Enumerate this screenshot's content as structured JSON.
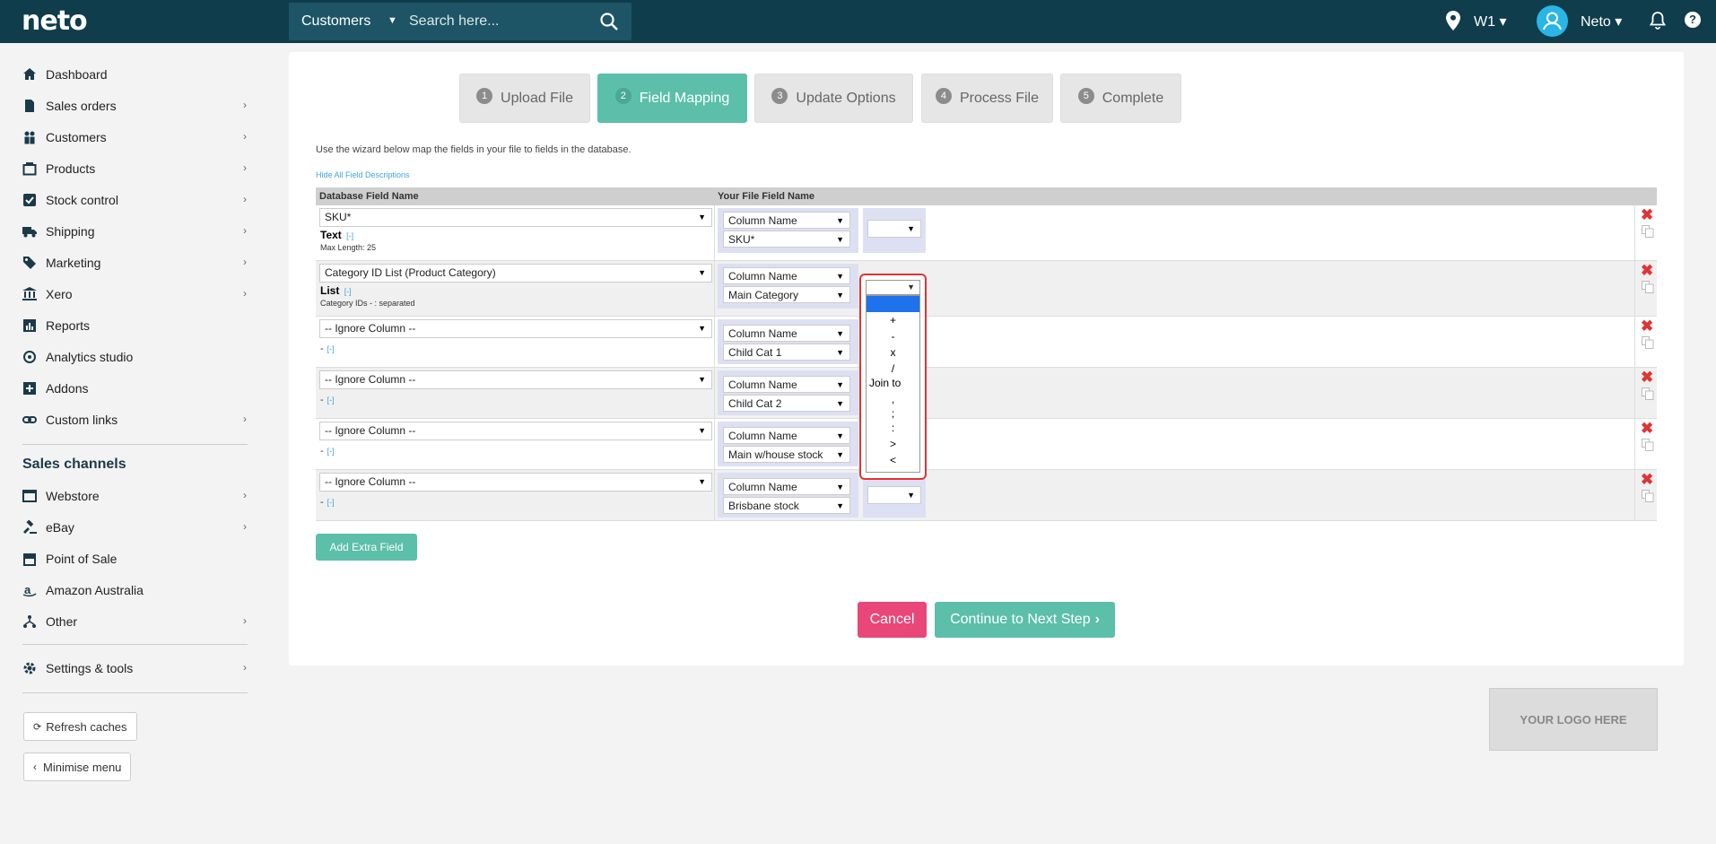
{
  "header": {
    "logo": "neto",
    "search_scope": "Customers",
    "search_placeholder": "Search here...",
    "location": "W1",
    "user": "Neto"
  },
  "sidebar": {
    "items": [
      {
        "label": "Dashboard",
        "icon": "home-icon",
        "chevron": false
      },
      {
        "label": "Sales orders",
        "icon": "document-icon",
        "chevron": true
      },
      {
        "label": "Customers",
        "icon": "users-icon",
        "chevron": true
      },
      {
        "label": "Products",
        "icon": "box-icon",
        "chevron": true
      },
      {
        "label": "Stock control",
        "icon": "checkbox-icon",
        "chevron": true
      },
      {
        "label": "Shipping",
        "icon": "truck-icon",
        "chevron": true
      },
      {
        "label": "Marketing",
        "icon": "tag-icon",
        "chevron": true
      },
      {
        "label": "Xero",
        "icon": "bank-icon",
        "chevron": true
      },
      {
        "label": "Reports",
        "icon": "chart-icon",
        "chevron": false
      },
      {
        "label": "Analytics studio",
        "icon": "analytics-icon",
        "chevron": false
      },
      {
        "label": "Addons",
        "icon": "plus-square-icon",
        "chevron": false
      },
      {
        "label": "Custom links",
        "icon": "link-icon",
        "chevron": true
      }
    ],
    "channels_title": "Sales channels",
    "channels": [
      {
        "label": "Webstore",
        "icon": "webstore-icon",
        "chevron": true
      },
      {
        "label": "eBay",
        "icon": "gavel-icon",
        "chevron": true
      },
      {
        "label": "Point of Sale",
        "icon": "store-icon",
        "chevron": false
      },
      {
        "label": "Amazon Australia",
        "icon": "amazon-icon",
        "chevron": false
      },
      {
        "label": "Other",
        "icon": "sitemap-icon",
        "chevron": true
      }
    ],
    "settings": "Settings & tools",
    "refresh": "Refresh caches",
    "minimise": "Minimise menu"
  },
  "wizard": {
    "steps": [
      {
        "num": "1",
        "label": "Upload File"
      },
      {
        "num": "2",
        "label": "Field Mapping"
      },
      {
        "num": "3",
        "label": "Update Options"
      },
      {
        "num": "4",
        "label": "Process File"
      },
      {
        "num": "5",
        "label": "Complete"
      }
    ],
    "intro": "Use the wizard below map the fields in your file to fields in the database.",
    "hide_link": "Hide All Field Descriptions",
    "col_db": "Database Field Name",
    "col_file": "Your File Field Name",
    "rows": [
      {
        "db": "SKU*",
        "type": "Text",
        "toggle": "[-]",
        "desc": "Max Length: 25",
        "map1": "Column Name",
        "map2": "SKU*"
      },
      {
        "db": "Category ID List (Product Category)",
        "type": "List",
        "toggle": "[-]",
        "desc": "Category IDs - : separated",
        "map1": "Column Name",
        "map2": "Main Category"
      },
      {
        "db": "-- Ignore Column --",
        "type": "-",
        "toggle": "[-]",
        "desc": "",
        "map1": "Column Name",
        "map2": "Child Cat 1"
      },
      {
        "db": "-- Ignore Column --",
        "type": "-",
        "toggle": "[-]",
        "desc": "",
        "map1": "Column Name",
        "map2": "Child Cat 2"
      },
      {
        "db": "-- Ignore Column --",
        "type": "-",
        "toggle": "[-]",
        "desc": "",
        "map1": "Column Name",
        "map2": "Main w/house stock"
      },
      {
        "db": "-- Ignore Column --",
        "type": "-",
        "toggle": "[-]",
        "desc": "",
        "map1": "Column Name",
        "map2": "Brisbane stock"
      }
    ],
    "add_field": "Add Extra Field",
    "cancel": "Cancel",
    "next": "Continue to Next Step",
    "operator_options": [
      "",
      "+",
      "-",
      "x",
      "/",
      "Join to",
      ",",
      ";",
      ":",
      ">",
      "<"
    ]
  },
  "logo_placeholder": "YOUR LOGO HERE",
  "colors": {
    "topbar": "#0f3d4c",
    "accent": "#5bbfa9",
    "danger": "#e9467a",
    "highlight": "#e23333"
  }
}
